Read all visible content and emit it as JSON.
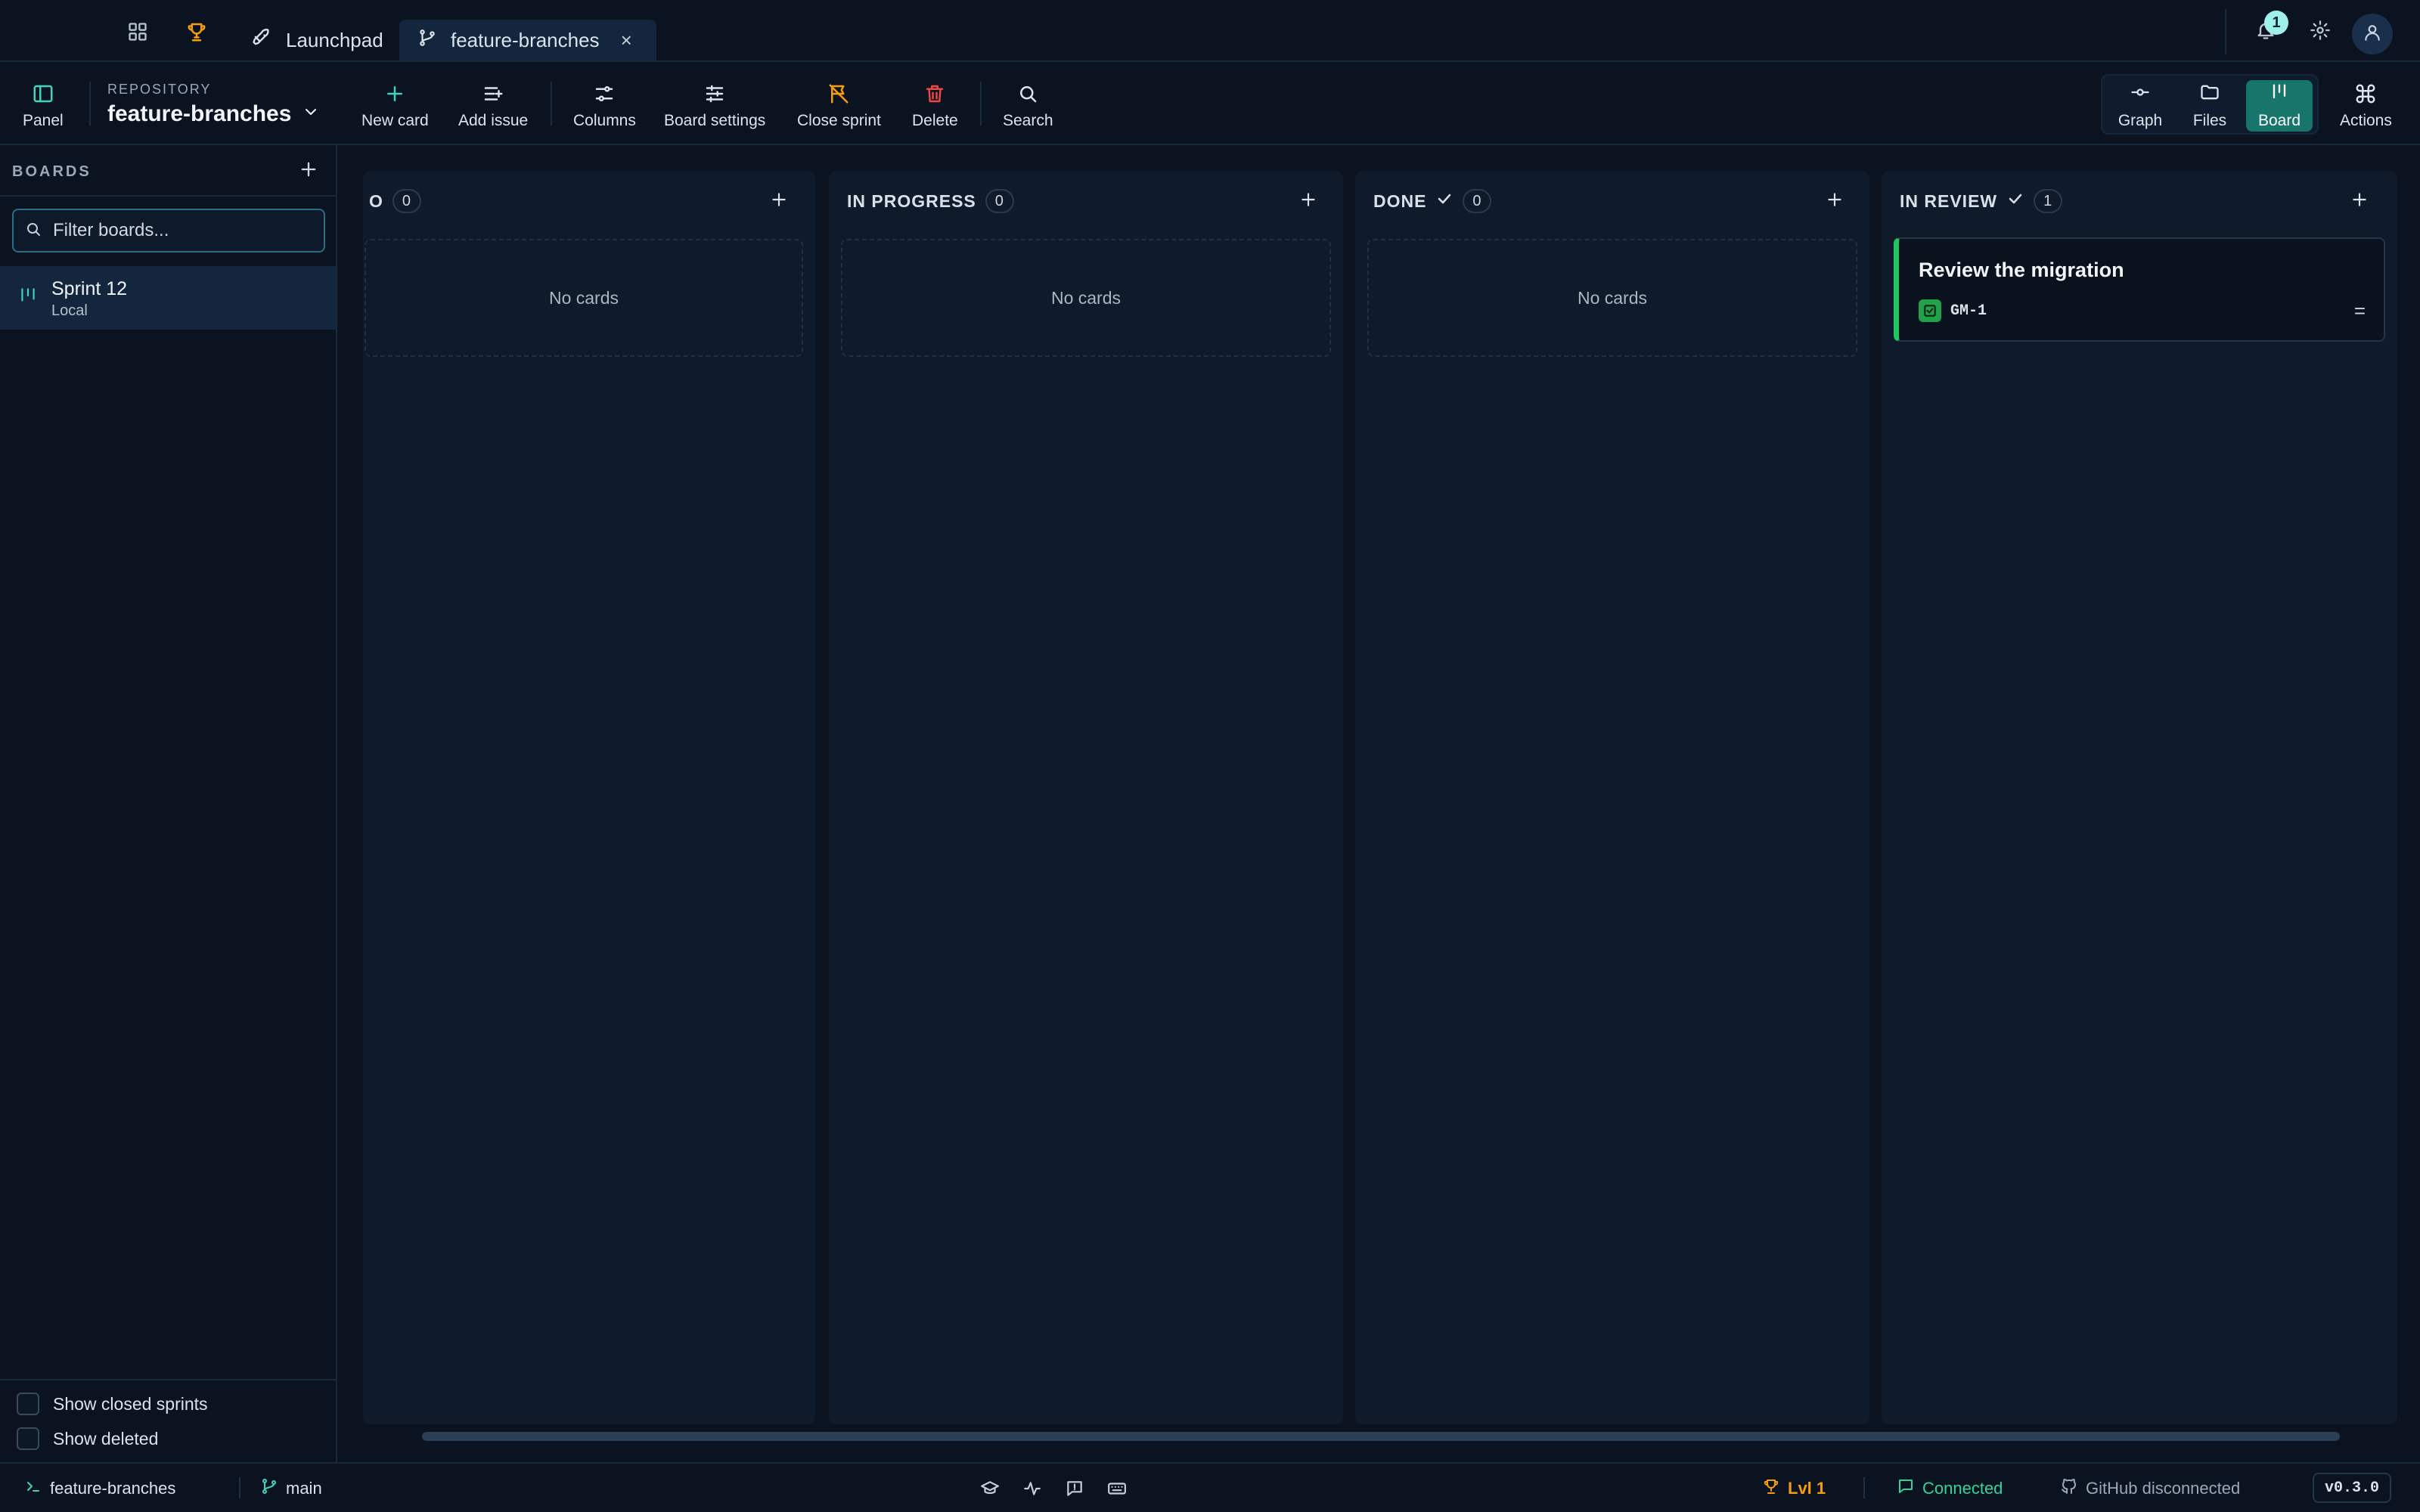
{
  "titlebar": {
    "tabs": [
      {
        "label": "Launchpad",
        "icon": "rocket-icon"
      },
      {
        "label": "feature-branches",
        "icon": "git-branch-icon",
        "close": "×"
      }
    ],
    "notification_count": "1"
  },
  "toolbar": {
    "panel_label": "Panel",
    "repo_caption": "REPOSITORY",
    "repo_name": "feature-branches",
    "new_card": "New card",
    "add_issue": "Add issue",
    "columns": "Columns",
    "board_settings": "Board settings",
    "close_sprint": "Close sprint",
    "delete": "Delete",
    "search": "Search",
    "views": {
      "graph": "Graph",
      "files": "Files",
      "board": "Board",
      "active": "Board"
    },
    "actions": "Actions"
  },
  "sidebar": {
    "heading": "BOARDS",
    "filter_placeholder": "Filter boards...",
    "boards": [
      {
        "name": "Sprint 12",
        "source": "Local"
      }
    ],
    "show_closed_sprints": "Show closed sprints",
    "show_deleted": "Show deleted"
  },
  "board": {
    "columns": [
      {
        "title": "O",
        "count": "0",
        "empty_text": "No cards"
      },
      {
        "title": "IN PROGRESS",
        "count": "0",
        "empty_text": "No cards"
      },
      {
        "title": "DONE",
        "count": "0",
        "empty_text": "No cards",
        "done": true
      },
      {
        "title": "IN REVIEW",
        "count": "1",
        "done": true,
        "cards": [
          {
            "title": "Review the migration",
            "id": "GM-1",
            "priority": "="
          }
        ]
      }
    ]
  },
  "statusbar": {
    "repo": "feature-branches",
    "branch": "main",
    "level": "Lvl 1",
    "connection": "Connected",
    "github": "GitHub disconnected",
    "version": "v0.3.0"
  },
  "colors": {
    "accent": "#17756b",
    "done_check": "#3fd3c0",
    "card_stripe": "#22c55e",
    "trophy": "#f59e0b",
    "delete": "#ef4444",
    "connected": "#34d399"
  }
}
